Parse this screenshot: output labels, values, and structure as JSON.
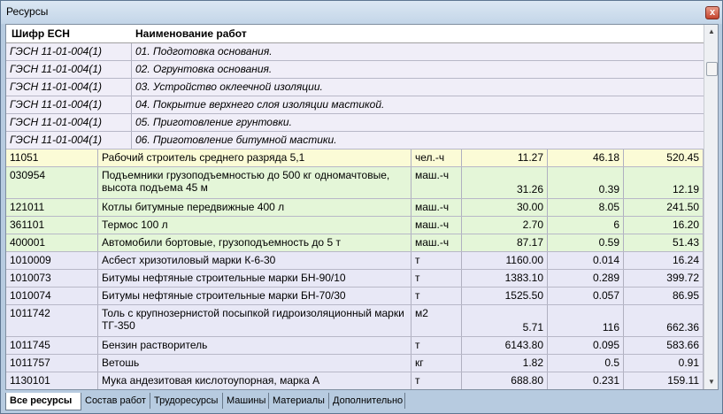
{
  "window": {
    "title": "Ресурсы",
    "close_label": "x"
  },
  "header": {
    "code": "Шифр ЕСН",
    "name": "Наименование работ"
  },
  "operations": [
    {
      "code": "ГЭСН 11-01-004(1)",
      "name": "01. Подготовка основания."
    },
    {
      "code": "ГЭСН 11-01-004(1)",
      "name": "02. Огрунтовка основания."
    },
    {
      "code": "ГЭСН 11-01-004(1)",
      "name": "03. Устройство оклеечной изоляции."
    },
    {
      "code": "ГЭСН 11-01-004(1)",
      "name": "04. Покрытие верхнего слоя изоляции мастикой."
    },
    {
      "code": "ГЭСН 11-01-004(1)",
      "name": "05. Приготовление грунтовки."
    },
    {
      "code": "ГЭСН 11-01-004(1)",
      "name": "06. Приготовление битумной мастики."
    }
  ],
  "resources": [
    {
      "code": "11051",
      "name": "Рабочий строитель среднего разряда 5,1",
      "unit": "чел.-ч",
      "v1": "11.27",
      "v2": "46.18",
      "v3": "520.45",
      "kind": "labor"
    },
    {
      "code": "030954",
      "name": "Подъемники грузоподъемностью до 500 кг одномачтовые, высота подъема 45 м",
      "unit": "маш.-ч",
      "v1": "31.26",
      "v2": "0.39",
      "v3": "12.19",
      "kind": "machine"
    },
    {
      "code": "121011",
      "name": "Котлы битумные передвижные 400 л",
      "unit": "маш.-ч",
      "v1": "30.00",
      "v2": "8.05",
      "v3": "241.50",
      "kind": "machine"
    },
    {
      "code": "361101",
      "name": "Термос 100 л",
      "unit": "маш.-ч",
      "v1": "2.70",
      "v2": "6",
      "v3": "16.20",
      "kind": "machine"
    },
    {
      "code": "400001",
      "name": "Автомобили бортовые, грузоподъемность до 5 т",
      "unit": "маш.-ч",
      "v1": "87.17",
      "v2": "0.59",
      "v3": "51.43",
      "kind": "machine"
    },
    {
      "code": "1010009",
      "name": "Асбест хризотиловый марки К-6-30",
      "unit": "т",
      "v1": "1160.00",
      "v2": "0.014",
      "v3": "16.24",
      "kind": "material"
    },
    {
      "code": "1010073",
      "name": "Битумы нефтяные строительные марки БН-90/10",
      "unit": "т",
      "v1": "1383.10",
      "v2": "0.289",
      "v3": "399.72",
      "kind": "material"
    },
    {
      "code": "1010074",
      "name": "Битумы нефтяные строительные марки БН-70/30",
      "unit": "т",
      "v1": "1525.50",
      "v2": "0.057",
      "v3": "86.95",
      "kind": "material"
    },
    {
      "code": "1011742",
      "name": "Толь с крупнозернистой посыпкой гидроизоляционный марки ТГ-350",
      "unit": "м2",
      "v1": "5.71",
      "v2": "116",
      "v3": "662.36",
      "kind": "material"
    },
    {
      "code": "1011745",
      "name": "Бензин растворитель",
      "unit": "т",
      "v1": "6143.80",
      "v2": "0.095",
      "v3": "583.66",
      "kind": "material"
    },
    {
      "code": "1011757",
      "name": "Ветошь",
      "unit": "кг",
      "v1": "1.82",
      "v2": "0.5",
      "v3": "0.91",
      "kind": "material"
    },
    {
      "code": "1130101",
      "name": "Мука андезитовая кислотоупорная, марка А",
      "unit": "т",
      "v1": "688.80",
      "v2": "0.231",
      "v3": "159.11",
      "kind": "material"
    }
  ],
  "row_colors": {
    "labor": "#fbfbd6",
    "machine": "#e4f6d8",
    "material": "#e8e8f6",
    "operation": "#f0eef8"
  },
  "tabs": [
    "Все ресурсы",
    "Состав работ",
    "Трудоресурсы",
    "Машины",
    "Материалы",
    "Дополнительно"
  ],
  "active_tab": 0
}
